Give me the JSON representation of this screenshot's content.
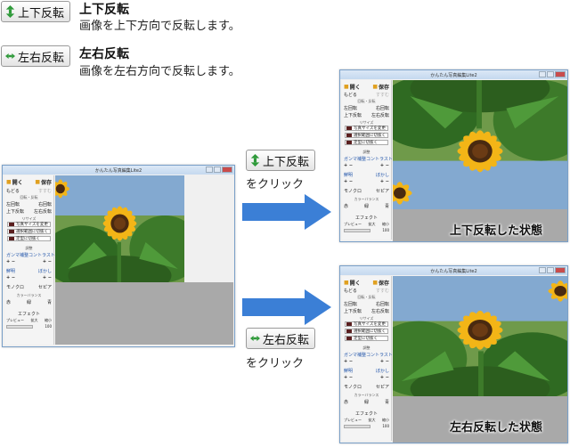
{
  "flip_vertical": {
    "button_label": "上下反転",
    "title": "上下反転",
    "description": "画像を上下方向で反転します。",
    "click_caption": "をクリック",
    "result_label": "上下反転した状態"
  },
  "flip_horizontal": {
    "button_label": "左右反転",
    "title": "左右反転",
    "description": "画像を左右方向で反転します。",
    "click_caption": "をクリック",
    "result_label": "左右反転した状態"
  },
  "window": {
    "title": "かんたん写真編集Lite2",
    "open": "開く",
    "save": "保存",
    "undo": "もどる",
    "redo": "すすむ",
    "rotate_section": "回転・反転",
    "rotate_left": "左回転",
    "rotate_right": "右回転",
    "flip_v": "上下反転",
    "flip_h": "左右反転",
    "resize_section": "リサイズ",
    "resize_photo": "写真サイズを変更",
    "crop_selection": "選択範囲に切抜く",
    "crop_fixed": "定型に切抜く",
    "adjust_section": "調整",
    "gamma": "ガンマ補整",
    "contrast": "コントラスト",
    "sharpen": "鮮明",
    "blur": "ぼかし",
    "mono": "モノクロ",
    "sepia": "セピア",
    "color_section": "カラーバランス",
    "red": "赤",
    "green": "緑",
    "blue": "青",
    "effect": "エフェクト",
    "preview": "プレビュー",
    "zoom_in": "拡大",
    "zoom_out": "縮小",
    "zoom_value": "100"
  },
  "colors": {
    "arrow": "#3b7fd6",
    "icon_green": "#2f9a3a",
    "sky": "#7a9cc4",
    "leaf": "#3e7a2e",
    "petal": "#f3b517",
    "center": "#4a2a10"
  }
}
